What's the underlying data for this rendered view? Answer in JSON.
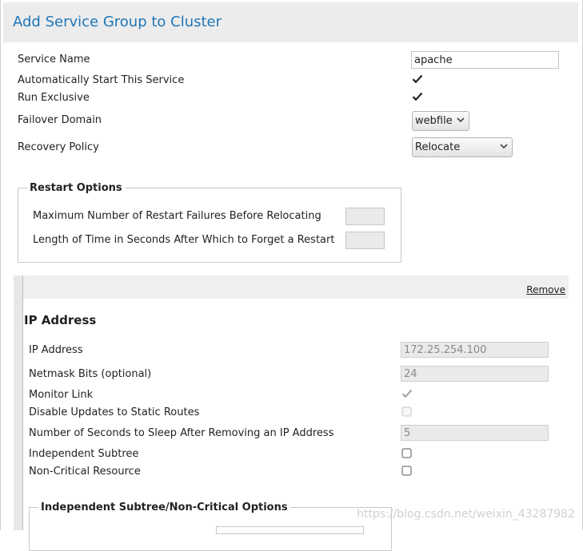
{
  "header": {
    "title": "Add Service Group to Cluster"
  },
  "service": {
    "name_label": "Service Name",
    "name_value": "apache",
    "autostart_label": "Automatically Start This Service",
    "autostart_checked": true,
    "exclusive_label": "Run Exclusive",
    "exclusive_checked": true,
    "failover_label": "Failover Domain",
    "failover_value": "webfile",
    "recovery_label": "Recovery Policy",
    "recovery_value": "Relocate"
  },
  "restart_options": {
    "legend": "Restart Options",
    "max_failures_label": "Maximum Number of Restart Failures Before Relocating",
    "max_failures_value": "",
    "forget_time_label": "Length of Time in Seconds After Which to Forget a Restart",
    "forget_time_value": ""
  },
  "resource": {
    "remove_label": "Remove",
    "title": "IP Address",
    "ip_label": "IP Address",
    "ip_value": "172.25.254.100",
    "netmask_label": "Netmask Bits (optional)",
    "netmask_value": "24",
    "monitor_label": "Monitor Link",
    "monitor_checked": true,
    "disable_updates_label": "Disable Updates to Static Routes",
    "disable_updates_checked": false,
    "sleep_label": "Number of Seconds to Sleep After Removing an IP Address",
    "sleep_value": "5",
    "independent_label": "Independent Subtree",
    "independent_checked": false,
    "noncritical_label": "Non-Critical Resource",
    "noncritical_checked": false,
    "subtree_legend": "Independent Subtree/Non-Critical Options"
  },
  "watermark": "https://blog.csdn.net/weixin_43287982",
  "colors": {
    "title_blue": "#1f76b8",
    "header_bg": "#ececec"
  }
}
